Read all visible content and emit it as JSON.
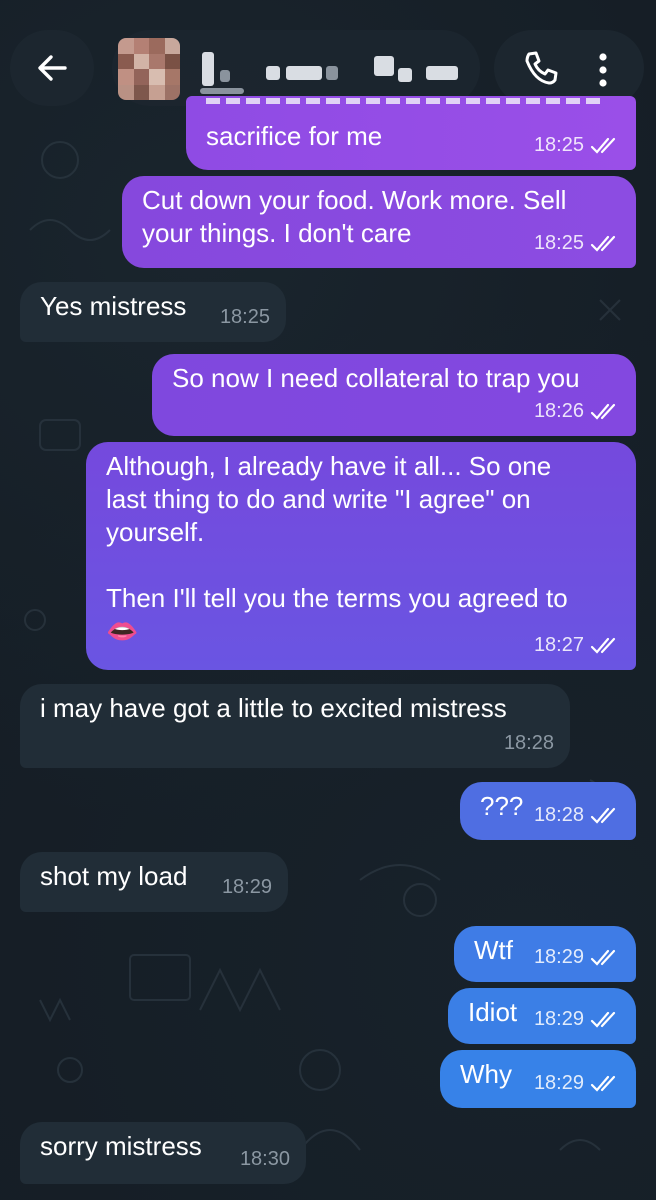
{
  "header": {
    "back_icon": "arrow-left-icon",
    "call_icon": "phone-icon",
    "menu_icon": "more-vertical-icon"
  },
  "messages": [
    {
      "dir": "out",
      "text": "sacrifice for me",
      "time": "18:25",
      "status": "read"
    },
    {
      "dir": "out",
      "text": "Cut down your food. Work more. Sell\nyour things. I don't care",
      "time": "18:25",
      "status": "read"
    },
    {
      "dir": "in",
      "text": "Yes mistress",
      "time": "18:25"
    },
    {
      "dir": "out",
      "text": "So now I need collateral to trap you",
      "time": "18:26",
      "status": "read"
    },
    {
      "dir": "out",
      "text": "Although, I already have it all... So one\nlast thing to do and write \"I agree\" on\nyourself.\n\nThen I'll tell you the terms you agreed to\n👄",
      "time": "18:27",
      "status": "read"
    },
    {
      "dir": "in",
      "text": "i may have got a little to excited mistress",
      "time": "18:28"
    },
    {
      "dir": "out",
      "text": "???",
      "time": "18:28",
      "status": "read"
    },
    {
      "dir": "in",
      "text": "shot my load",
      "time": "18:29"
    },
    {
      "dir": "out",
      "text": "Wtf",
      "time": "18:29",
      "status": "read"
    },
    {
      "dir": "out",
      "text": "Idiot",
      "time": "18:29",
      "status": "read"
    },
    {
      "dir": "out",
      "text": "Why",
      "time": "18:29",
      "status": "read"
    },
    {
      "dir": "in",
      "text": "sorry mistress",
      "time": "18:30"
    }
  ],
  "colors": {
    "background": "#151d25",
    "incoming_bubble": "#212d37",
    "outgoing_purple": "#8a4fe0",
    "outgoing_blue": "#3d7fe6"
  }
}
